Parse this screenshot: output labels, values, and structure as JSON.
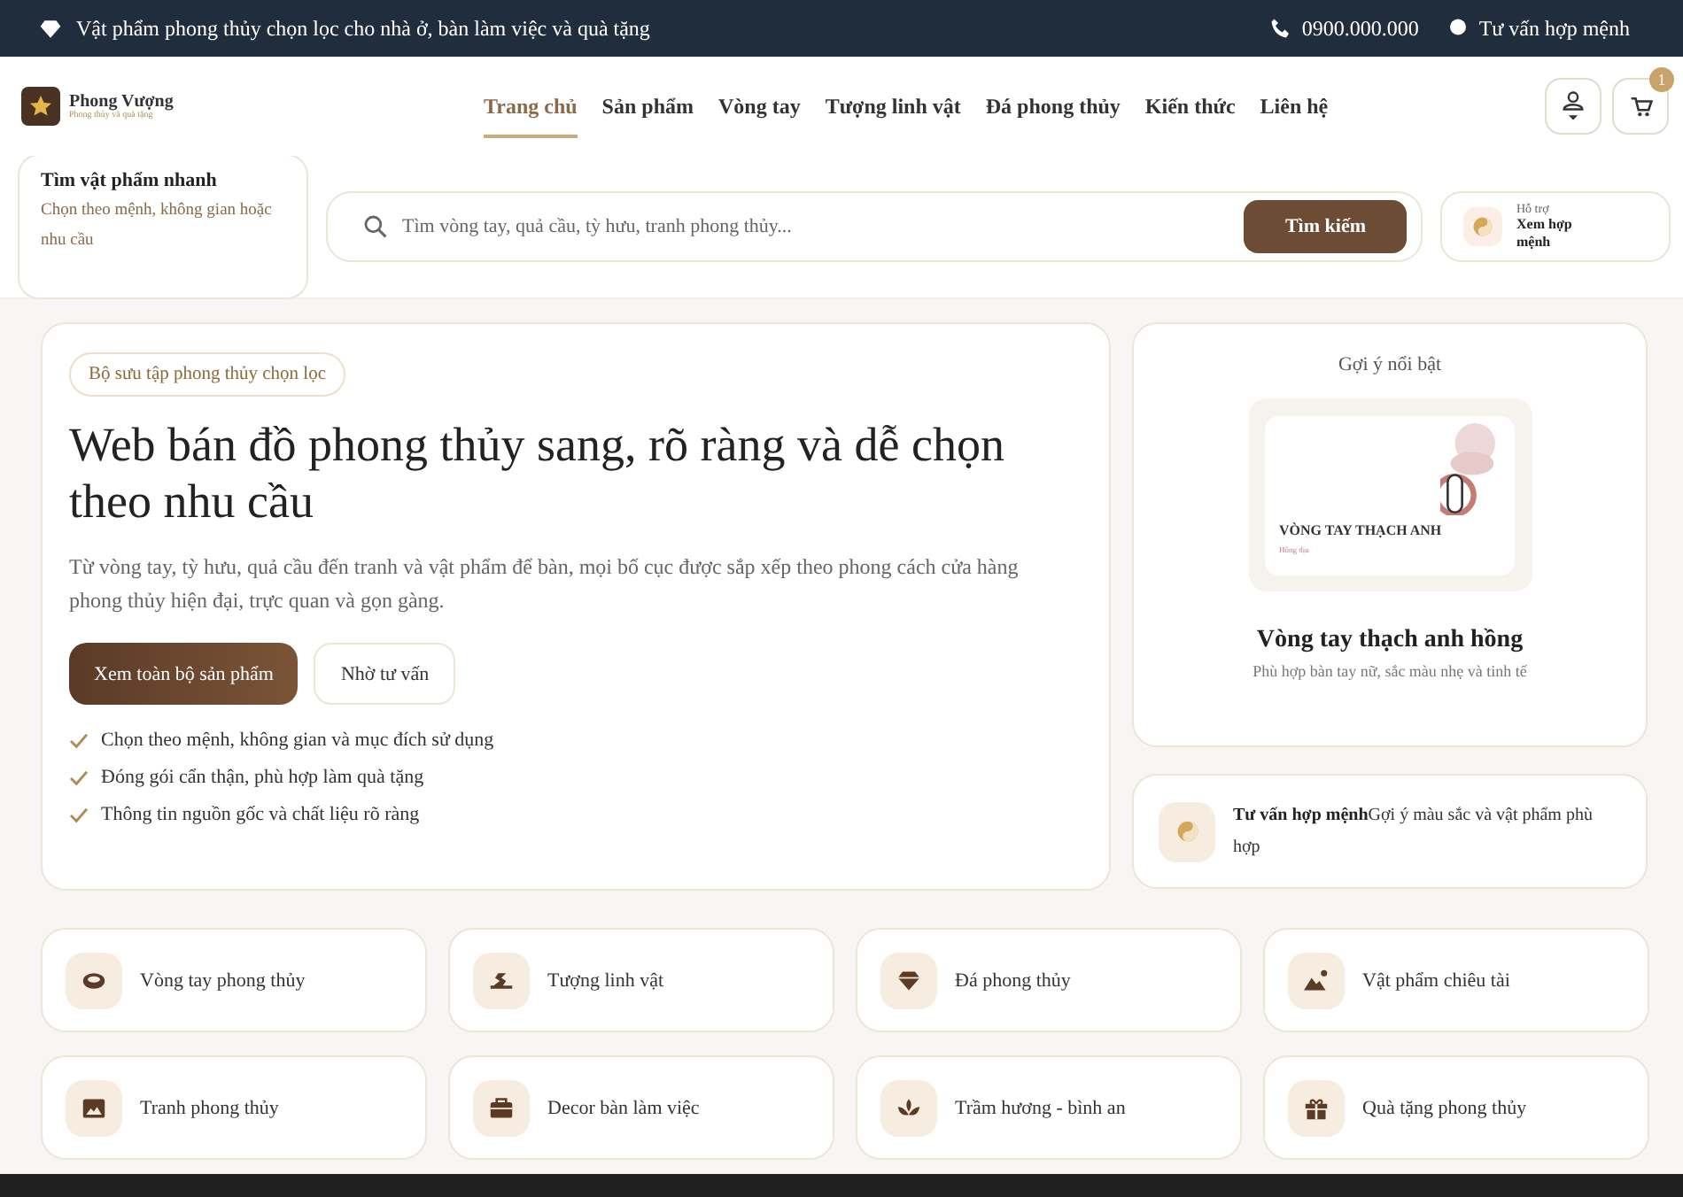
{
  "topbar": {
    "tagline": "Vật phẩm phong thủy chọn lọc cho nhà ở, bàn làm việc và quà tặng",
    "phone": "0900.000.000",
    "consult": "Tư vấn hợp mệnh"
  },
  "header": {
    "brand": "Phong Vượng",
    "brand_sub": "Phong thủy và quà tặng",
    "cart_count": "1",
    "nav": [
      {
        "label": "Trang chủ",
        "selected": true
      },
      {
        "label": "Sản phẩm",
        "selected": false
      },
      {
        "label": "Vòng tay",
        "selected": false
      },
      {
        "label": "Tượng linh vật",
        "selected": false
      },
      {
        "label": "Đá phong thủy",
        "selected": false
      },
      {
        "label": "Kiến thức",
        "selected": false
      },
      {
        "label": "Liên hệ",
        "selected": false
      }
    ]
  },
  "quick_find": {
    "title": "Tìm vật phẩm nhanh",
    "text": "Chọn theo mệnh, không gian hoặc nhu cầu"
  },
  "search": {
    "placeholder": "Tìm vòng tay, quả cầu, tỳ hưu, tranh phong thủy...",
    "button": "Tìm kiếm"
  },
  "support": {
    "small": "Hỗ trợ",
    "label": "Xem hợp mệnh"
  },
  "hero": {
    "badge": "Bộ sưu tập phong thủy chọn lọc",
    "title": "Web bán đồ phong thủy sang, rõ ràng và dễ chọn theo nhu cầu",
    "text": "Từ vòng tay, tỳ hưu, quả cầu đến tranh và vật phẩm để bàn, mọi bố cục được sắp xếp theo phong cách cửa hàng phong thủy hiện đại, trực quan và gọn gàng.",
    "primary": "Xem toàn bộ sản phẩm",
    "secondary": "Nhờ tư vấn",
    "points": [
      "Chọn theo mệnh, không gian và mục đích sử dụng",
      "Đóng gói cẩn thận, phù hợp làm quà tặng",
      "Thông tin nguồn gốc và chất liệu rõ ràng"
    ]
  },
  "featured": {
    "heading": "Gợi ý nổi bật",
    "preview_title": "VÒNG TAY THẠCH ANH",
    "preview_sub": "Hồng dịu",
    "name": "Vòng tay thạch anh hồng",
    "desc": "Phù hợp bàn tay nữ, sắc màu nhẹ và tinh tế"
  },
  "consult": {
    "title": "Tư vấn hợp mệnh",
    "text": "Gợi ý màu sắc và vật phẩm phù hợp"
  },
  "categories": [
    {
      "label": "Vòng tay phong thủy",
      "kind": "ring"
    },
    {
      "label": "Tượng linh vật",
      "kind": "statue"
    },
    {
      "label": "Đá phong thủy",
      "kind": "gem"
    },
    {
      "label": "Vật phẩm chiêu tài",
      "kind": "mountain"
    },
    {
      "label": "Tranh phong thủy",
      "kind": "picture"
    },
    {
      "label": "Decor bàn làm việc",
      "kind": "briefcase"
    },
    {
      "label": "Trầm hương - bình an",
      "kind": "lotus"
    },
    {
      "label": "Quà tặng phong thủy",
      "kind": "gift"
    }
  ]
}
